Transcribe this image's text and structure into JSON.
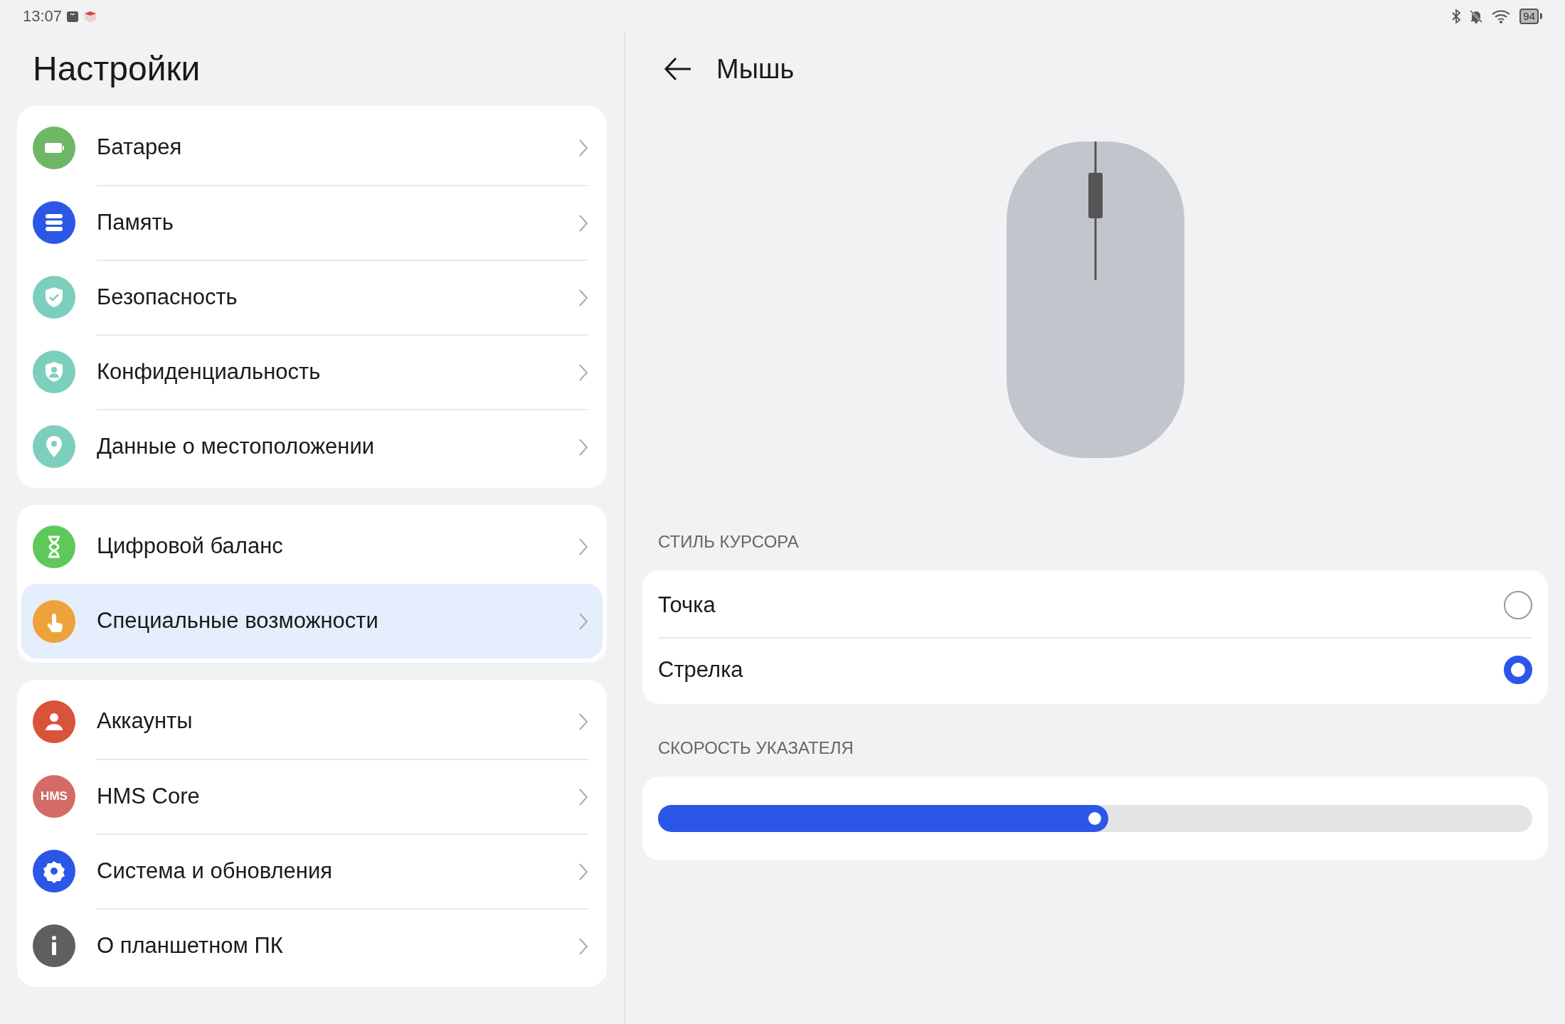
{
  "status_bar": {
    "time": "13:07",
    "battery": "94"
  },
  "settings": {
    "title": "Настройки",
    "groups": [
      {
        "items": [
          {
            "label": "Батарея",
            "kind": "battery",
            "color": "#6db766",
            "selected": false
          },
          {
            "label": "Память",
            "kind": "storage",
            "color": "#2b56e8",
            "selected": false
          },
          {
            "label": "Безопасность",
            "kind": "shield",
            "color": "#7ccfbd",
            "selected": false
          },
          {
            "label": "Конфиденциальность",
            "kind": "privacy",
            "color": "#7ccfbd",
            "selected": false
          },
          {
            "label": "Данные о местоположении",
            "kind": "location",
            "color": "#7ccfbd",
            "selected": false
          }
        ]
      },
      {
        "items": [
          {
            "label": "Цифровой баланс",
            "kind": "hourglass",
            "color": "#5ec95a",
            "selected": false
          },
          {
            "label": "Специальные возможности",
            "kind": "hand",
            "color": "#eea23b",
            "selected": true
          }
        ]
      },
      {
        "items": [
          {
            "label": "Аккаунты",
            "kind": "person",
            "color": "#d9533b",
            "selected": false
          },
          {
            "label": "HMS Core",
            "kind": "text",
            "icon_text": "HMS",
            "color": "#d56b66",
            "selected": false
          },
          {
            "label": "Система и обновления",
            "kind": "gear",
            "color": "#2b56e8",
            "selected": false
          },
          {
            "label": "О планшетном ПК",
            "kind": "info",
            "color": "#5f5f5f",
            "selected": false
          }
        ]
      }
    ]
  },
  "detail": {
    "title": "Мышь",
    "cursor_style": {
      "heading": "СТИЛЬ КУРСОРА",
      "options": [
        {
          "label": "Точка",
          "selected": false
        },
        {
          "label": "Стрелка",
          "selected": true
        }
      ]
    },
    "pointer_speed": {
      "heading": "СКОРОСТЬ УКАЗАТЕЛЯ",
      "level": 0.515
    }
  }
}
